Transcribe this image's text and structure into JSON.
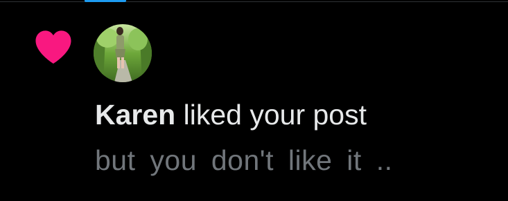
{
  "notification": {
    "type_icon": "heart-icon",
    "like_color": "#f91880",
    "user": {
      "name": "Karen",
      "avatar": "profile-photo"
    },
    "action_text": "liked your post",
    "post_preview": "but you don't like it .."
  },
  "colors": {
    "background": "#000000",
    "primary_text": "#e7e9ea",
    "secondary_text": "#71767b",
    "accent": "#1d9bf0"
  }
}
